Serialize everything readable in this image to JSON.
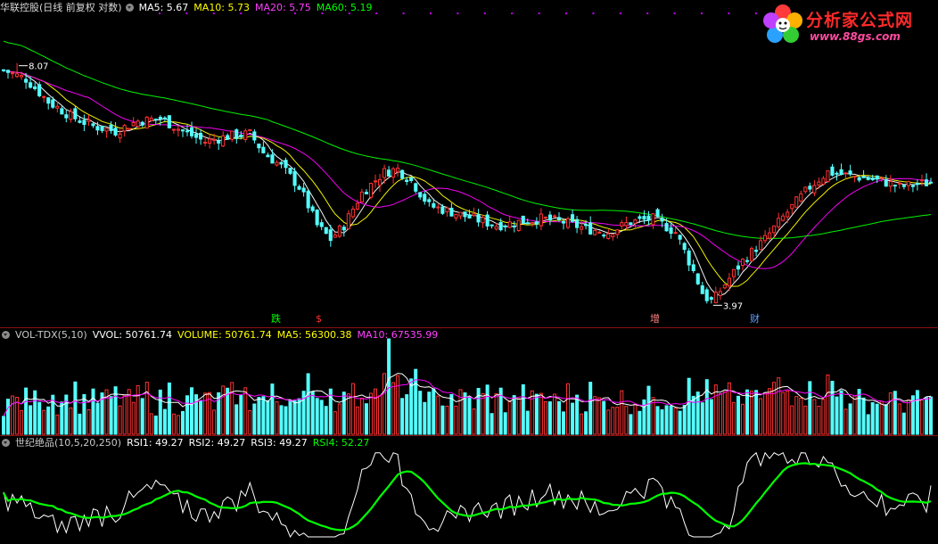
{
  "price_header": {
    "title": "华联控股(日线 前复权 对数)",
    "ma5": "MA5: 5.67",
    "ma10": "MA10: 5.73",
    "ma20": "MA20: 5.75",
    "ma60": "MA60: 5.19"
  },
  "volume_header": {
    "title": "VOL-TDX(5,10)",
    "vvol": "VVOL: 50761.74",
    "volume": "VOLUME: 50761.74",
    "ma5": "MA5: 56300.38",
    "ma10": "MA10: 67535.99"
  },
  "rsi_header": {
    "title": "世纪绝品(10,5,20,250)",
    "rsi1": "RSI1: 49.27",
    "rsi2": "RSI2: 49.27",
    "rsi3": "RSI3: 49.27",
    "rsi4": "RSI4: 52.27"
  },
  "logo": {
    "title": "分析家公式网",
    "url": "www.88gs.com"
  },
  "markers": {
    "die": "跌",
    "dollar": "$",
    "zeng": "增",
    "cai": "财"
  },
  "colors": {
    "up": "#ff3232",
    "down": "#54ffff",
    "ma5": "#ffffff",
    "ma10": "#ffff00",
    "ma20": "#ff00ff",
    "ma60": "#00ff00",
    "rsi_line": "#ffffff",
    "rsi4": "#00ff00",
    "separator": "#8b1010",
    "header_circle": "#8a8a8a",
    "dots": "#c000ff"
  },
  "chart_data": {
    "type": "candlestick",
    "title": "华联控股(日线 前复权 对数)",
    "price_labels": {
      "high": "8.07",
      "low": "3.97"
    },
    "high_value": 8.07,
    "low_value": 3.97,
    "close_anchors": [
      [
        0,
        7.9
      ],
      [
        5,
        7.7
      ],
      [
        10,
        7.2
      ],
      [
        15,
        6.9
      ],
      [
        20,
        6.7
      ],
      [
        25,
        6.6
      ],
      [
        30,
        6.8
      ],
      [
        35,
        6.85
      ],
      [
        40,
        6.6
      ],
      [
        45,
        6.4
      ],
      [
        50,
        6.5
      ],
      [
        55,
        6.55
      ],
      [
        58,
        6.2
      ],
      [
        62,
        5.95
      ],
      [
        66,
        5.6
      ],
      [
        70,
        5.0
      ],
      [
        73,
        4.8
      ],
      [
        76,
        5.0
      ],
      [
        80,
        5.5
      ],
      [
        85,
        5.85
      ],
      [
        88,
        5.9
      ],
      [
        91,
        5.7
      ],
      [
        95,
        5.3
      ],
      [
        100,
        5.2
      ],
      [
        105,
        5.1
      ],
      [
        110,
        5.0
      ],
      [
        115,
        5.05
      ],
      [
        120,
        5.1
      ],
      [
        125,
        5.05
      ],
      [
        130,
        4.95
      ],
      [
        135,
        4.9
      ],
      [
        140,
        5.05
      ],
      [
        145,
        5.1
      ],
      [
        150,
        4.9
      ],
      [
        153,
        4.5
      ],
      [
        156,
        4.1
      ],
      [
        158,
        3.97
      ],
      [
        161,
        4.2
      ],
      [
        165,
        4.5
      ],
      [
        170,
        4.8
      ],
      [
        175,
        5.2
      ],
      [
        180,
        5.6
      ],
      [
        184,
        5.85
      ],
      [
        188,
        5.8
      ],
      [
        192,
        5.75
      ],
      [
        196,
        5.7
      ],
      [
        200,
        5.6
      ],
      [
        204,
        5.65
      ],
      [
        207,
        5.67
      ]
    ],
    "candle_count": 208,
    "ma_periods": [
      5,
      10,
      20,
      60
    ],
    "ma_values_last": {
      "ma5": 5.67,
      "ma10": 5.73,
      "ma20": 5.75,
      "ma60": 5.19
    },
    "volume": {
      "vvol_last": 50761.74,
      "volume_last": 50761.74,
      "ma5_last": 56300.38,
      "ma10_last": 67535.99,
      "spike_index": 86,
      "spike_multiplier": 4.2
    },
    "rsi": {
      "params": [
        10,
        5,
        20,
        250
      ],
      "rsi1_last": 49.27,
      "rsi2_last": 49.27,
      "rsi3_last": 49.27,
      "rsi4_last": 52.27
    }
  }
}
